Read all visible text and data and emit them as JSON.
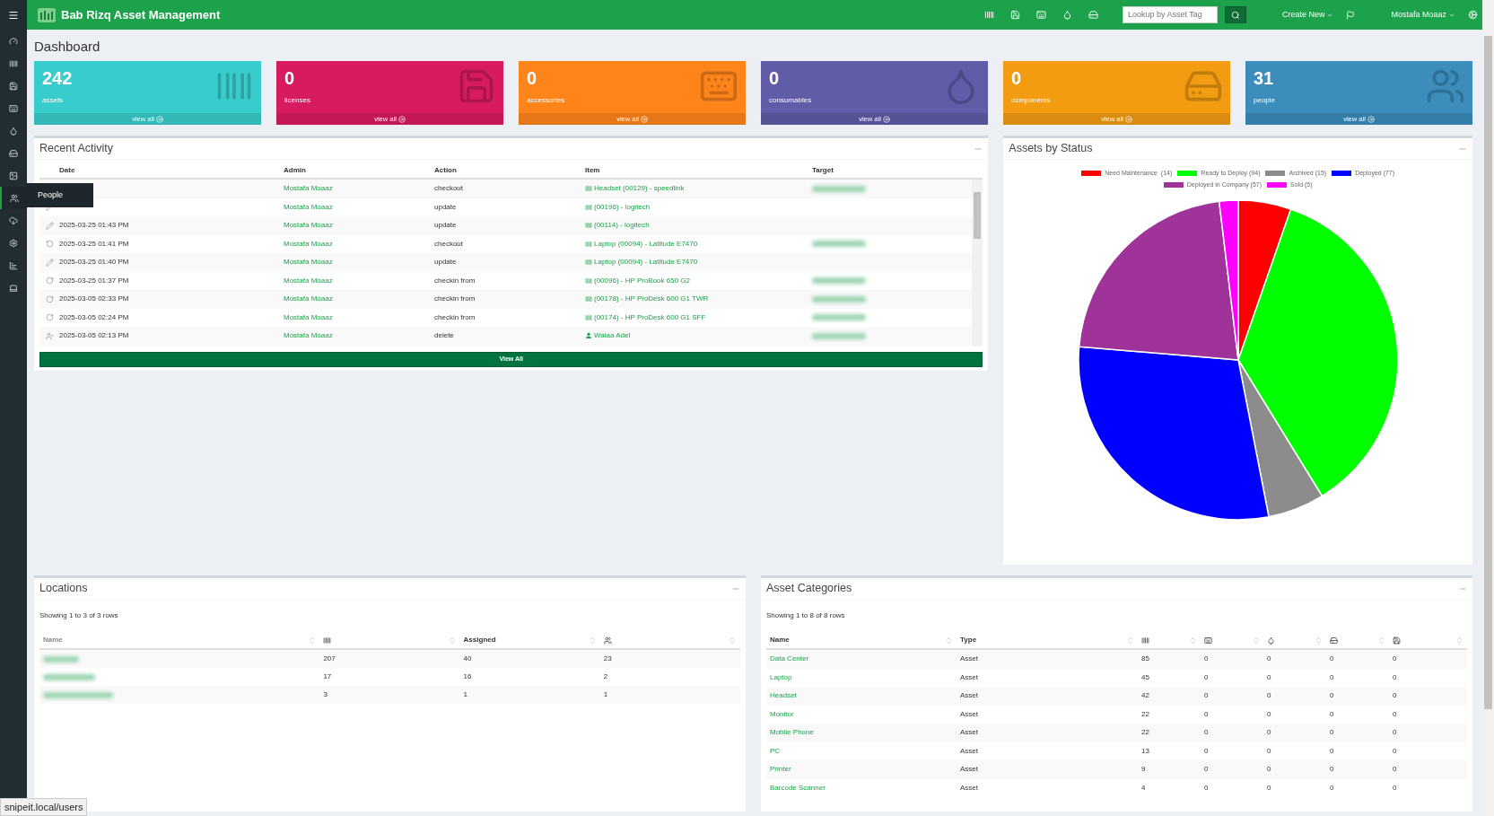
{
  "brand": {
    "title": "Bab Rizq Asset Management"
  },
  "topbar": {
    "search": {
      "placeholder": "Lookup by Asset Tag"
    },
    "create_new": "Create New",
    "user": "Mostafa Moaaz"
  },
  "sidebar": {
    "items": [
      {
        "selected": false
      },
      {
        "selected": false
      },
      {
        "selected": false
      },
      {
        "selected": false
      },
      {
        "selected": false
      },
      {
        "selected": false
      },
      {
        "selected": false
      },
      {
        "selected": true
      },
      {
        "selected": false
      },
      {
        "selected": false
      },
      {
        "selected": false
      },
      {
        "selected": false
      }
    ],
    "tooltip": "People"
  },
  "page_title": "Dashboard",
  "stat_cards": [
    {
      "count": "242",
      "label": "assets",
      "link": "view all",
      "color": "#39cccc"
    },
    {
      "count": "0",
      "label": "licenses",
      "link": "view all",
      "color": "#d81b60"
    },
    {
      "count": "0",
      "label": "accessories",
      "link": "view all",
      "color": "#ff851b"
    },
    {
      "count": "0",
      "label": "consumables",
      "link": "view all",
      "color": "#605ca8"
    },
    {
      "count": "0",
      "label": "components",
      "link": "view all",
      "color": "#f39c12"
    },
    {
      "count": "31",
      "label": "people",
      "link": "view all",
      "color": "#3c8dbc"
    }
  ],
  "recent_activity": {
    "title": "Recent Activity",
    "columns": [
      "Date",
      "Admin",
      "Action",
      "Item",
      "Target"
    ],
    "rows": [
      {
        "admin": "Mostafa Moaaz",
        "action": "checkout",
        "item": "Headset (00129) - speedlink",
        "target_redacted": true
      },
      {
        "kind": "edit",
        "admin": "Mostafa Moaaz",
        "action": "update",
        "item": "(00196) - logitech",
        "target_redacted": false
      },
      {
        "kind": "edit",
        "date": "2025-03-25 01:43 PM",
        "admin": "Mostafa Moaaz",
        "action": "update",
        "item": "(00114) - logitech",
        "target_redacted": false
      },
      {
        "kind": "checkout",
        "date": "2025-03-25 01:41 PM",
        "admin": "Mostafa Moaaz",
        "action": "checkout",
        "item": "Laptop (00094) - Latitude E7470",
        "target_redacted": true
      },
      {
        "kind": "edit",
        "date": "2025-03-25 01:40 PM",
        "admin": "Mostafa Moaaz",
        "action": "update",
        "item": "Laptop (00094) - Latitude E7470",
        "target_redacted": false
      },
      {
        "kind": "checkin",
        "date": "2025-03-25 01:37 PM",
        "admin": "Mostafa Moaaz",
        "action": "checkin from",
        "item": "(00096) - HP ProBook 650 G2",
        "target_redacted": true
      },
      {
        "kind": "checkin",
        "date": "2025-03-05 02:33 PM",
        "admin": "Mostafa Moaaz",
        "action": "checkin from",
        "item": "(00178) - HP ProDesk 600 G1 TWR",
        "target_redacted": true
      },
      {
        "kind": "checkin",
        "date": "2025-03-05 02:24 PM",
        "admin": "Mostafa Moaaz",
        "action": "checkin from",
        "item": "(00174) - HP ProDesk 600 G1 SFF",
        "target_redacted": true
      },
      {
        "kind": "delete",
        "date": "2025-03-05 02:13 PM",
        "admin": "Mostafa Moaaz",
        "action": "delete",
        "item": "Walaa Adel",
        "target_redacted": true
      }
    ],
    "button": "View All"
  },
  "assets_by_status": {
    "title": "Assets by Status",
    "legend": [
      {
        "label": "Need Maintenance  (14)",
        "color": "#ff0000"
      },
      {
        "label": "Ready to Deploy (94)",
        "color": "#00ff00"
      },
      {
        "label": "Archived (15)",
        "color": "#8c8c8c"
      },
      {
        "label": "Deployed (77)",
        "color": "#0000ff"
      },
      {
        "label": "Deployed in Company (57)",
        "color": "#a0339a"
      },
      {
        "label": "Sold (5)",
        "color": "#ff00ff"
      }
    ],
    "chart_data": {
      "type": "pie",
      "values": [
        5.34,
        35.87,
        5.73,
        29.39,
        21.76,
        1.91
      ]
    }
  },
  "locations": {
    "title": "Locations",
    "summary": "Showing 1 to 3 of 3 rows",
    "columns": [
      {
        "kind": "text",
        "label": "Name"
      },
      {
        "kind": "icon"
      },
      {
        "kind": "text",
        "label": "Assigned"
      },
      {
        "kind": "icon"
      }
    ],
    "rows": [
      [
        "",
        "207",
        "40",
        "23"
      ],
      [
        "",
        "17",
        "16",
        "2"
      ],
      [
        "",
        "3",
        "1",
        "1"
      ]
    ]
  },
  "asset_categories": {
    "title": "Asset Categories",
    "summary": "Showing 1 to 8 of 8 rows",
    "columns": [
      {
        "kind": "text",
        "label": "Name"
      },
      {
        "kind": "text",
        "label": "Type"
      },
      {
        "kind": "icon"
      },
      {
        "kind": "icon"
      },
      {
        "kind": "icon"
      },
      {
        "kind": "icon"
      },
      {
        "kind": "icon"
      }
    ],
    "rows": [
      [
        "Data Center",
        "Asset",
        "85",
        "0",
        "0",
        "0",
        "0"
      ],
      [
        "Laptop",
        "Asset",
        "45",
        "0",
        "0",
        "0",
        "0"
      ],
      [
        "Headset",
        "Asset",
        "42",
        "0",
        "0",
        "0",
        "0"
      ],
      [
        "Monitor",
        "Asset",
        "22",
        "0",
        "0",
        "0",
        "0"
      ],
      [
        "Mobile Phone",
        "Asset",
        "22",
        "0",
        "0",
        "0",
        "0"
      ],
      [
        "PC",
        "Asset",
        "13",
        "0",
        "0",
        "0",
        "0"
      ],
      [
        "Printer",
        "Asset",
        "9",
        "0",
        "0",
        "0",
        "0"
      ],
      [
        "Barcode Scanner",
        "Asset",
        "4",
        "0",
        "0",
        "0",
        "0"
      ]
    ]
  },
  "status_url": "snipeit.local/users"
}
